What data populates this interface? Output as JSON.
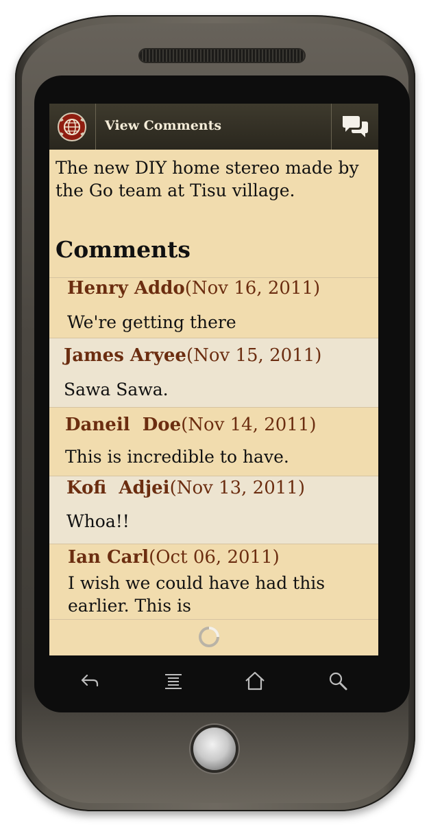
{
  "actionbar": {
    "title": "View Comments",
    "app_icon": "globe-gear-icon",
    "comment_icon": "speech-bubbles-icon"
  },
  "post": {
    "description": "The new DIY home stereo made by the Go team at Tisu village."
  },
  "comments_heading": "Comments",
  "comments": [
    {
      "author": "Henry Addo",
      "date": "(Nov 16, 2011)",
      "text": "We're getting there"
    },
    {
      "author": "James Aryee",
      "date": "(Nov 15, 2011)",
      "text": "Sawa Sawa."
    },
    {
      "author": "Daneil  Doe",
      "date": "(Nov 14, 2011)",
      "text": "This is incredible to have."
    },
    {
      "author": "Kofi  Adjei",
      "date": "(Nov 13, 2011)",
      "text": "Whoa!!"
    },
    {
      "author": "Ian Carl",
      "date": "(Oct 06, 2011)",
      "text": "I wish we could have had this earlier. This is"
    }
  ],
  "softkeys": [
    "back-icon",
    "menu-icon",
    "home-icon",
    "search-icon"
  ],
  "colors": {
    "actionbar": "#2f2c22",
    "background": "#f1dcae",
    "alt_row": "#ede4d0",
    "author": "#6b2d10",
    "text": "#111111"
  }
}
